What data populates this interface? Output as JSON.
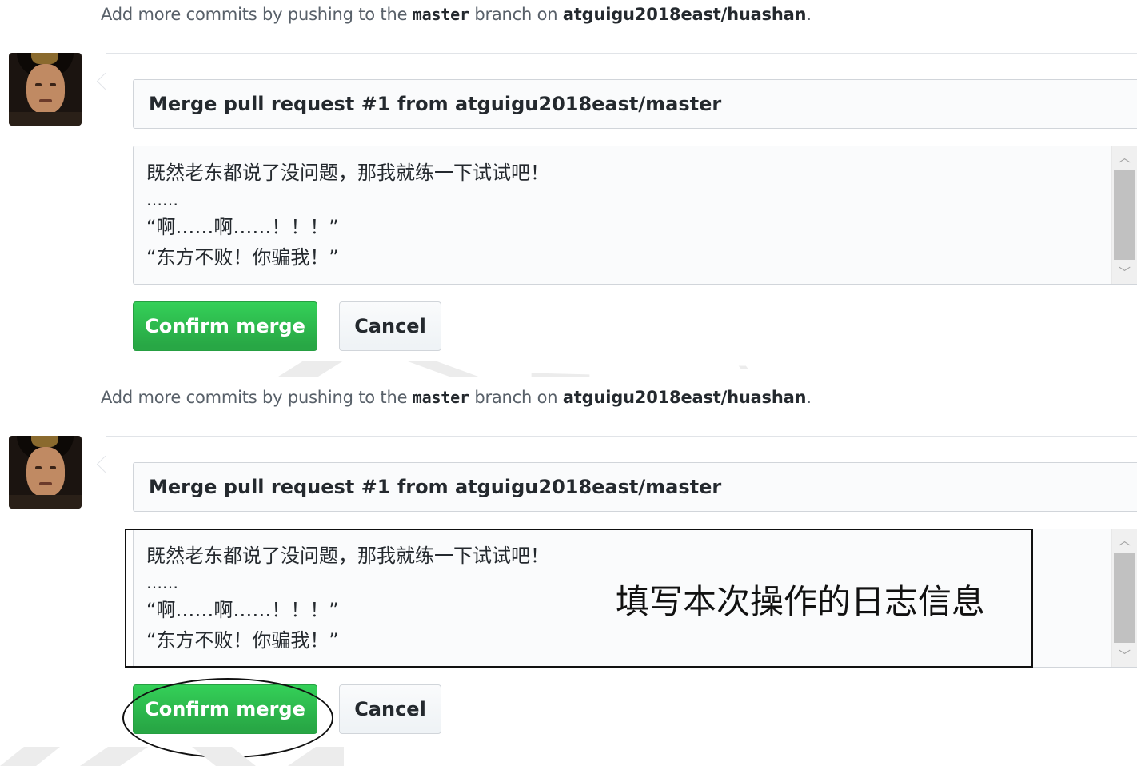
{
  "panels": [
    {
      "info": {
        "prefix": "Add more commits by pushing to the",
        "branch": "master",
        "middle": "branch on",
        "repo": "atguigu2018east/huashan",
        "suffix": "."
      },
      "commit_title": "Merge pull request #1 from atguigu2018east/master",
      "commit_message_lines": [
        "既然老东都说了没问题，那我就练一下试试吧！",
        "……",
        "“啊……啊……！！！”",
        "“东方不败！你骗我！”"
      ],
      "confirm_label": "Confirm merge",
      "cancel_label": "Cancel"
    },
    {
      "info": {
        "prefix": "Add more commits by pushing to the",
        "branch": "master",
        "middle": "branch on",
        "repo": "atguigu2018east/huashan",
        "suffix": "."
      },
      "commit_title": "Merge pull request #1 from atguigu2018east/master",
      "commit_message_lines": [
        "既然老东都说了没问题，那我就练一下试试吧！",
        "……",
        "“啊……啊……！！！”",
        "“东方不败！你骗我！”"
      ],
      "confirm_label": "Confirm merge",
      "cancel_label": "Cancel",
      "annotation": "填写本次操作的日志信息"
    }
  ],
  "colors": {
    "confirm_green": "#2cbe4e",
    "annotation_ink": "#111111",
    "watermark": "#ececec"
  },
  "icons": {
    "scroll_up": "chevron-up-icon",
    "scroll_down": "chevron-down-icon"
  }
}
